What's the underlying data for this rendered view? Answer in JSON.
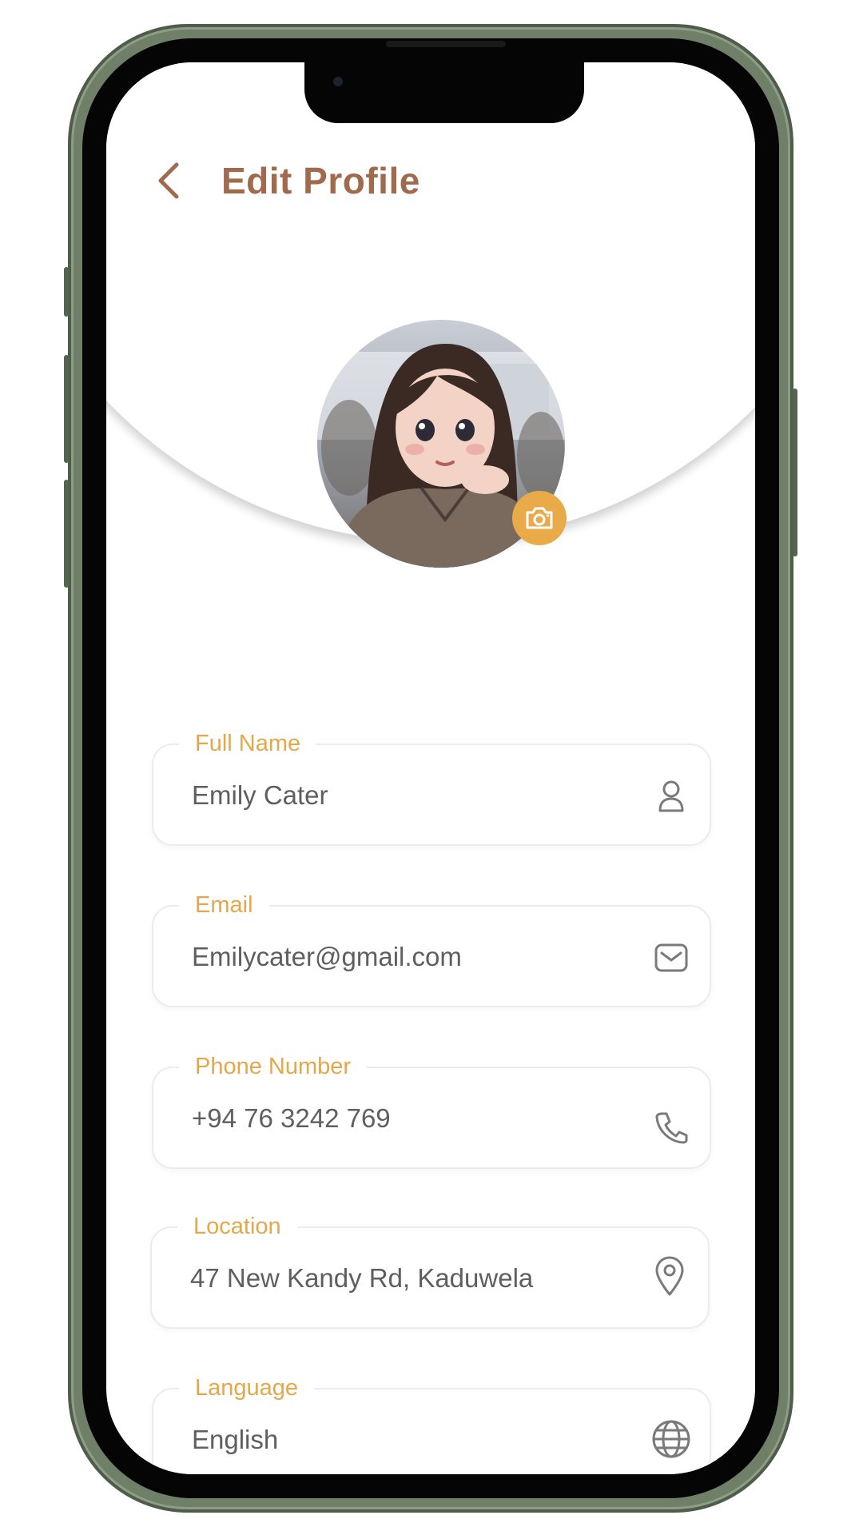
{
  "header": {
    "title": "Edit Profile"
  },
  "icons": {
    "back": "chevron-left-icon",
    "camera": "camera-icon",
    "user": "user-icon",
    "mail": "mail-icon",
    "phone": "phone-icon",
    "location": "location-pin-icon",
    "globe": "globe-icon"
  },
  "colors": {
    "title": "#a06a4e",
    "label": "#e4a84a",
    "camera_button": "#e9aa4a",
    "value_text": "#5f5f5f",
    "phone_frame": "#6f7f68"
  },
  "form": {
    "full_name": {
      "label": "Full Name",
      "value": "Emily Cater"
    },
    "email": {
      "label": "Email",
      "value": "Emilycater@gmail.com"
    },
    "phone": {
      "label": "Phone Number",
      "value": "+94 76 3242 769"
    },
    "location": {
      "label": "Location",
      "value": "47 New Kandy Rd, Kaduwela"
    },
    "language": {
      "label": "Language",
      "value": "English"
    }
  }
}
